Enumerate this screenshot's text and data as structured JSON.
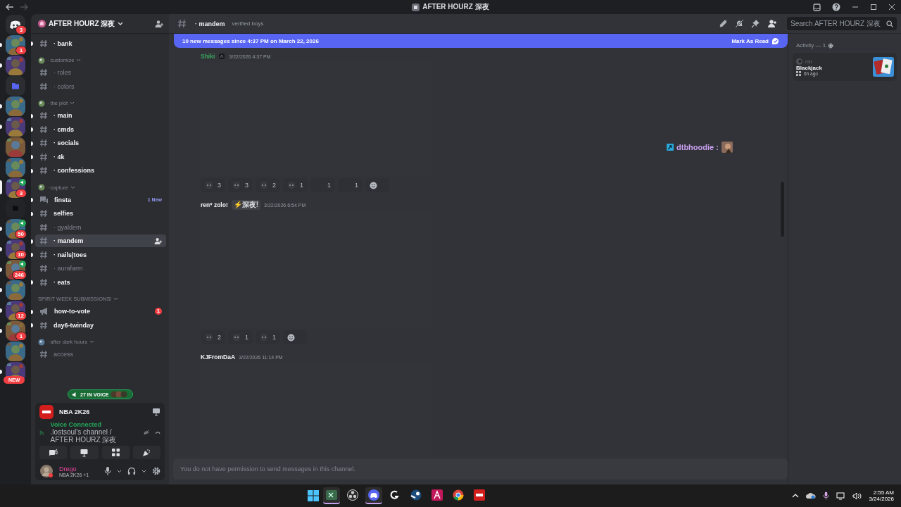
{
  "title_bar": {
    "title": "AFTER HOURZ 深夜"
  },
  "servers": [
    {
      "kind": "home",
      "badge": "3",
      "unread": false,
      "selected": false,
      "voice": false
    },
    {
      "kind": "server",
      "badge": "1",
      "unread": true,
      "selected": false,
      "voice": false
    },
    {
      "kind": "server",
      "unread": true,
      "selected": false,
      "voice": false
    },
    {
      "kind": "folder",
      "unread": false,
      "selected": false,
      "voice": false
    },
    {
      "kind": "server",
      "unread": true,
      "selected": false,
      "voice": false
    },
    {
      "kind": "server",
      "unread": true,
      "selected": false,
      "voice": false
    },
    {
      "kind": "server",
      "unread": false,
      "selected": false,
      "voice": false
    },
    {
      "kind": "server",
      "unread": false,
      "selected": false,
      "voice": false
    },
    {
      "kind": "server",
      "badge": "3",
      "unread": false,
      "selected": true,
      "voice": true
    },
    {
      "kind": "dark",
      "unread": false,
      "selected": false,
      "voice": false
    },
    {
      "kind": "server",
      "badge": "50",
      "unread": true,
      "selected": false,
      "voice": true
    },
    {
      "kind": "server",
      "badge": "10",
      "unread": true,
      "selected": false,
      "voice": false
    },
    {
      "kind": "server",
      "badge": "246",
      "unread": true,
      "selected": false,
      "voice": true
    },
    {
      "kind": "server",
      "unread": true,
      "selected": false,
      "voice": false
    },
    {
      "kind": "server",
      "badge": "12",
      "unread": true,
      "selected": false,
      "voice": false
    },
    {
      "kind": "server",
      "badge": "1",
      "unread": true,
      "selected": false,
      "voice": false
    },
    {
      "kind": "server",
      "unread": false,
      "selected": false,
      "voice": false
    },
    {
      "kind": "server",
      "unread": true,
      "selected": false,
      "voice": false
    }
  ],
  "new_pill": "NEW",
  "server_header": {
    "name": "AFTER HOURZ 深夜"
  },
  "channels": [
    {
      "kind": "channel",
      "name": "· bank",
      "unread": true,
      "selected": false
    },
    {
      "kind": "category",
      "name": "· customize",
      "icon": true
    },
    {
      "kind": "channel",
      "name": "· roles",
      "unread": false,
      "selected": false
    },
    {
      "kind": "channel",
      "name": "· colors",
      "unread": false,
      "selected": false
    },
    {
      "kind": "category",
      "name": "· the plot",
      "icon": true
    },
    {
      "kind": "channel",
      "name": "· main",
      "unread": true,
      "selected": false
    },
    {
      "kind": "channel",
      "name": "· cmds",
      "unread": true,
      "selected": false
    },
    {
      "kind": "channel",
      "name": "· socials",
      "unread": true,
      "selected": false
    },
    {
      "kind": "channel",
      "name": "· 4k",
      "unread": true,
      "selected": false
    },
    {
      "kind": "channel",
      "name": "· confessions",
      "unread": true,
      "selected": false
    },
    {
      "kind": "category",
      "name": "· capture",
      "icon": true
    },
    {
      "kind": "forum",
      "name": "finsta",
      "unread": true,
      "selected": false,
      "badge": "1 New"
    },
    {
      "kind": "channel",
      "name": "selfies",
      "unread": true,
      "selected": false
    },
    {
      "kind": "channel",
      "name": "· gyaldem",
      "unread": false,
      "selected": false
    },
    {
      "kind": "channel",
      "name": "· mandem",
      "unread": true,
      "selected": true
    },
    {
      "kind": "channel",
      "name": "· nails|toes",
      "unread": true,
      "selected": false
    },
    {
      "kind": "channel",
      "name": "· aurafarm",
      "unread": false,
      "selected": false
    },
    {
      "kind": "channel",
      "name": "· eats",
      "unread": true,
      "selected": false
    },
    {
      "kind": "category",
      "name": "SPIRIT WEEK SUBMISSIONS!",
      "icon": false
    },
    {
      "kind": "announcement",
      "name": "how-to-vote",
      "unread": true,
      "selected": false,
      "count": "1"
    },
    {
      "kind": "channel",
      "name": "day6-twinday",
      "unread": true,
      "selected": false
    },
    {
      "kind": "category",
      "name": "· after dark hours",
      "icon": true
    },
    {
      "kind": "channel",
      "name": "access",
      "unread": false,
      "selected": false
    }
  ],
  "voice_pill": "27 IN VOICE",
  "activity_panel": {
    "game": "NBA 2K26"
  },
  "voice": {
    "status": "Voice Connected",
    "channel": ".lostsoul's channel / AFTER HOURZ 深夜"
  },
  "user": {
    "name": "Drego",
    "status": "NBA 2K26 +1"
  },
  "chat_header": {
    "channel": "· mandem",
    "topic": "verified boys"
  },
  "new_banner": {
    "text": "10 new messages since 4:37 PM on March 22, 2026",
    "action": "Mark As Read"
  },
  "messages": [
    {
      "author": "Shiki",
      "color": "#3ba55d",
      "role_icon": true,
      "time": "3/22/2026 4:37 PM",
      "reactions": [
        {
          "kind": "emoji",
          "count": "3"
        },
        {
          "kind": "emoji",
          "count": "3"
        },
        {
          "kind": "emoji",
          "count": "2"
        },
        {
          "kind": "emoji",
          "count": "1"
        },
        {
          "kind": "blank",
          "count": "1"
        },
        {
          "kind": "blank",
          "count": "1"
        }
      ]
    },
    {
      "author": "ren* zolo!",
      "color": "#f2f3f5",
      "tag": "⚡深夜!",
      "time": "3/22/2026 6:54 PM",
      "reactions": [
        {
          "kind": "emoji",
          "count": "2"
        },
        {
          "kind": "emoji",
          "count": "1"
        },
        {
          "kind": "emoji",
          "count": "1"
        }
      ]
    },
    {
      "author": "KJFromDaA",
      "color": "#f2f3f5",
      "time": "3/22/2026 11:14 PM"
    }
  ],
  "overlay": {
    "name": "dtbhoodie :"
  },
  "composer": {
    "placeholder": "You do not have permission to send messages in this channel."
  },
  "search": {
    "placeholder": "Search AFTER HOURZ 深夜"
  },
  "activity": {
    "heading": "Activity — 1",
    "items": [
      {
        "user": "mir",
        "title": "Blackjack",
        "time": "6h ago"
      }
    ]
  },
  "taskbar": {
    "apps": [
      {
        "kind": "terminal",
        "active": true
      },
      {
        "kind": "obs",
        "active": false
      },
      {
        "kind": "discord",
        "active": true
      },
      {
        "kind": "gaming",
        "active": false
      },
      {
        "kind": "steam",
        "active": false
      },
      {
        "kind": "pen",
        "active": false
      },
      {
        "kind": "chrome",
        "active": false
      },
      {
        "kind": "game",
        "active": false
      }
    ],
    "time": "2:55 AM",
    "date": "3/24/2026"
  }
}
